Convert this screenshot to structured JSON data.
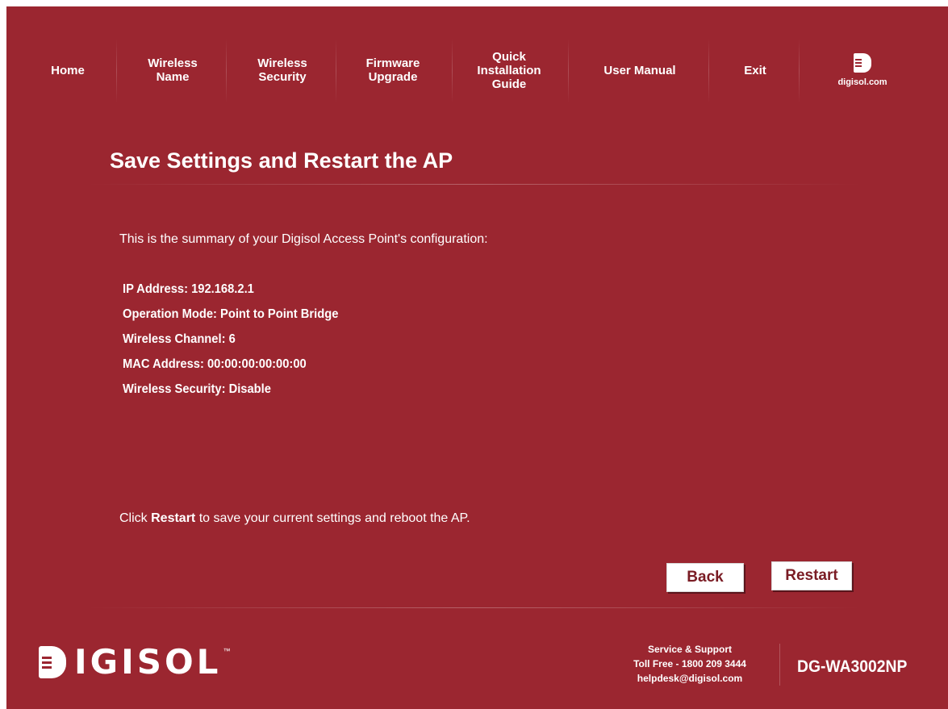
{
  "nav": {
    "home": "Home",
    "wireless_name": [
      "Wireless",
      "Name"
    ],
    "wireless_security": [
      "Wireless",
      "Security"
    ],
    "firmware_upgrade": [
      "Firmware",
      "Upgrade"
    ],
    "quick_install": [
      "Quick",
      "Installation",
      "Guide"
    ],
    "user_manual": "User Manual",
    "exit": "Exit",
    "brand_site": "digisol.com"
  },
  "page": {
    "title": "Save Settings and Restart the AP",
    "intro": "This is the summary of your Digisol Access Point's configuration:",
    "summary": [
      "IP Address: 192.168.2.1",
      "Operation Mode: Point to Point Bridge",
      "Wireless Channel: 6",
      "MAC Address: 00:00:00:00:00:00",
      "Wireless Security: Disable"
    ],
    "instruction_pre": "Click ",
    "instruction_bold": "Restart",
    "instruction_post": " to save your current settings and reboot the AP."
  },
  "buttons": {
    "back": "Back",
    "restart": "Restart"
  },
  "footer": {
    "logo_text": "IGISOL",
    "trademark": "™",
    "support_title": "Service & Support",
    "toll_free": "Toll Free - 1800 209 3444",
    "email": "helpdesk@digisol.com",
    "model": "DG-WA3002NP"
  },
  "colors": {
    "background": "#9b2630",
    "text": "#ffffff",
    "button_text": "#7a1c24"
  }
}
